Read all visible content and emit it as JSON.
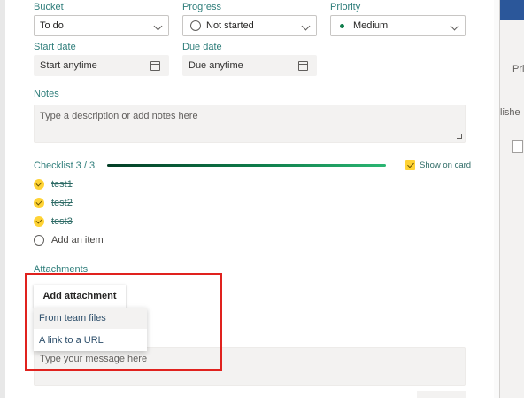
{
  "fields": {
    "bucket": {
      "label": "Bucket",
      "value": "To do"
    },
    "progress": {
      "label": "Progress",
      "value": "Not started"
    },
    "priority": {
      "label": "Priority",
      "value": "Medium"
    },
    "start_date": {
      "label": "Start date",
      "value": "Start anytime"
    },
    "due_date": {
      "label": "Due date",
      "value": "Due anytime"
    }
  },
  "notes": {
    "label": "Notes",
    "placeholder": "Type a description or add notes here"
  },
  "checklist": {
    "label": "Checklist 3 / 3",
    "completed": 3,
    "total": 3,
    "show_on_card_label": "Show on card",
    "items": [
      {
        "text": "test1",
        "done": true
      },
      {
        "text": "test2",
        "done": true
      },
      {
        "text": "test3",
        "done": true
      }
    ],
    "add_item_label": "Add an item"
  },
  "attachments": {
    "label": "Attachments",
    "add_button": "Add attachment",
    "menu": [
      "From team files",
      "A link to a URL"
    ]
  },
  "comment": {
    "placeholder": "Type your message here"
  },
  "right_panel": {
    "text1": "Pri",
    "text2": "lishe"
  },
  "colors": {
    "label_teal": "#2e7d7a",
    "check_yellow": "#ffd335",
    "priority_dot": "#0f7d4b",
    "highlight_red": "#e0221e"
  },
  "icons": [
    "chevron-down-icon",
    "calendar-icon",
    "check-circle-icon",
    "empty-circle-icon",
    "checkbox-icon"
  ]
}
